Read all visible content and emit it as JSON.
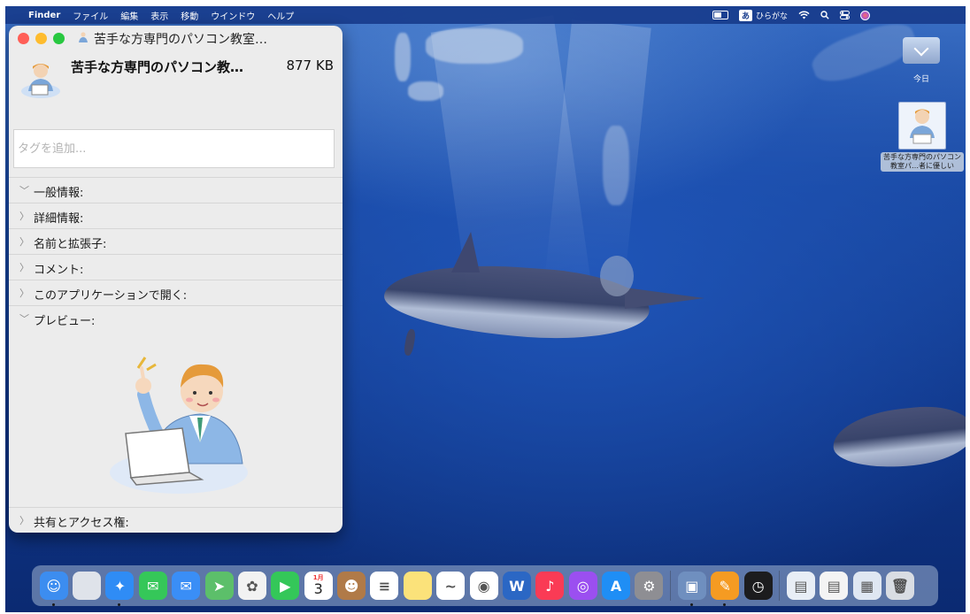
{
  "menubar": {
    "apple_icon": "apple-icon",
    "app_name": "Finder",
    "items": [
      "ファイル",
      "編集",
      "表示",
      "移動",
      "ウインドウ",
      "ヘルプ"
    ],
    "ime_badge": "あ",
    "ime_label": "ひらがな",
    "status_icons": [
      "battery-icon",
      "wifi-icon",
      "spotlight-icon",
      "control-center-icon",
      "siri-icon"
    ]
  },
  "desktop": {
    "today_label": "今日",
    "file_caption": "苦手な方専門のパソコン教室パ…者に優しい"
  },
  "info_window": {
    "title": "苦手な方専門のパソコン教室…",
    "file_name": "苦手な方専門のパソコン教…",
    "file_size": "877 KB",
    "tag_placeholder": "タグを追加...",
    "sections": [
      {
        "label": "一般情報:",
        "expanded": true
      },
      {
        "label": "詳細情報:",
        "expanded": false
      },
      {
        "label": "名前と拡張子:",
        "expanded": false
      },
      {
        "label": "コメント:",
        "expanded": false
      },
      {
        "label": "このアプリケーションで開く:",
        "expanded": false
      },
      {
        "label": "プレビュー:",
        "expanded": true
      },
      {
        "label": "共有とアクセス権:",
        "expanded": false
      }
    ]
  },
  "dock": {
    "calendar_day": "3",
    "calendar_month": "1月",
    "apps": [
      {
        "name": "finder",
        "color": "#3c8df0",
        "running": true
      },
      {
        "name": "launchpad",
        "color": "#dfe3ea"
      },
      {
        "name": "safari",
        "color": "#2f8cf5",
        "running": true
      },
      {
        "name": "messages",
        "color": "#35c759"
      },
      {
        "name": "mail",
        "color": "#3a8ef6"
      },
      {
        "name": "maps",
        "color": "#5cbf6a"
      },
      {
        "name": "photos",
        "color": "#f2f2f2"
      },
      {
        "name": "facetime",
        "color": "#34c759"
      },
      {
        "name": "calendar",
        "color": "#ffffff"
      },
      {
        "name": "contacts",
        "color": "#b07a48"
      },
      {
        "name": "reminders",
        "color": "#ffffff"
      },
      {
        "name": "notes",
        "color": "#fbe27a"
      },
      {
        "name": "freeform",
        "color": "#ffffff"
      },
      {
        "name": "chrome",
        "color": "#ffffff"
      },
      {
        "name": "word",
        "color": "#2b67c4"
      },
      {
        "name": "music",
        "color": "#fa3b55"
      },
      {
        "name": "podcasts",
        "color": "#9b4ff0"
      },
      {
        "name": "app-store",
        "color": "#1f8ef5"
      },
      {
        "name": "system-settings",
        "color": "#8e8e93"
      },
      {
        "name": "preview",
        "color": "#6f8fbf",
        "running": true
      },
      {
        "name": "pages",
        "color": "#f59b22",
        "running": true
      },
      {
        "name": "clock",
        "color": "#1c1c1e"
      },
      {
        "name": "downloads-stack",
        "color": "#e8eef6"
      },
      {
        "name": "recent-document-1",
        "color": "#f4f4f4"
      },
      {
        "name": "recent-document-2",
        "color": "#dfe7f2"
      },
      {
        "name": "trash",
        "color": "#d9dde3"
      }
    ]
  }
}
